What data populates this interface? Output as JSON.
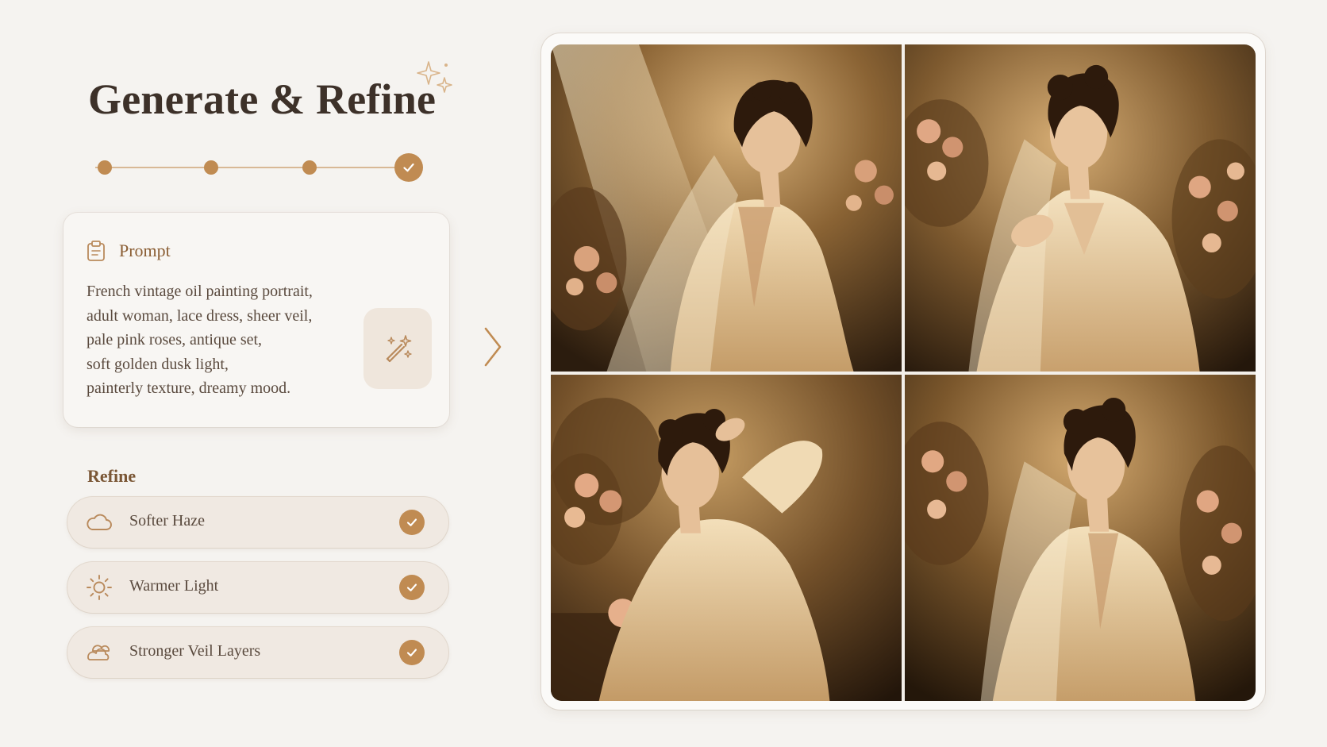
{
  "header": {
    "title": "Generate & Refine"
  },
  "stepper": {
    "total_steps": 4,
    "current_step": 4,
    "completed_icon": "check-icon"
  },
  "prompt": {
    "label": "Prompt",
    "icon": "clipboard-icon",
    "lines": [
      "French vintage oil painting portrait,",
      "adult woman, lace dress, sheer veil,",
      "pale pink roses, antique set,",
      "soft golden dusk light,",
      "painterly texture, dreamy mood."
    ],
    "action_icon": "magic-wand-icon"
  },
  "refine": {
    "heading": "Refine",
    "items": [
      {
        "label": "Softer Haze",
        "icon": "cloud-icon",
        "checked": true
      },
      {
        "label": "Warmer Light",
        "icon": "sun-icon",
        "checked": true
      },
      {
        "label": "Stronger Veil Layers",
        "icon": "veil-layers-icon",
        "checked": true
      }
    ]
  },
  "gallery": {
    "layout": "2x2",
    "images": [
      {
        "subject": "woman-back-view-veil-roses"
      },
      {
        "subject": "woman-hand-on-chest-roses"
      },
      {
        "subject": "woman-hand-in-hair-chair-roses"
      },
      {
        "subject": "woman-back-view-looking-down-roses"
      }
    ]
  },
  "colors": {
    "background": "#f5f3f0",
    "accent": "#c08b52",
    "title": "#3d3129",
    "body_text": "#5a4a3e"
  }
}
